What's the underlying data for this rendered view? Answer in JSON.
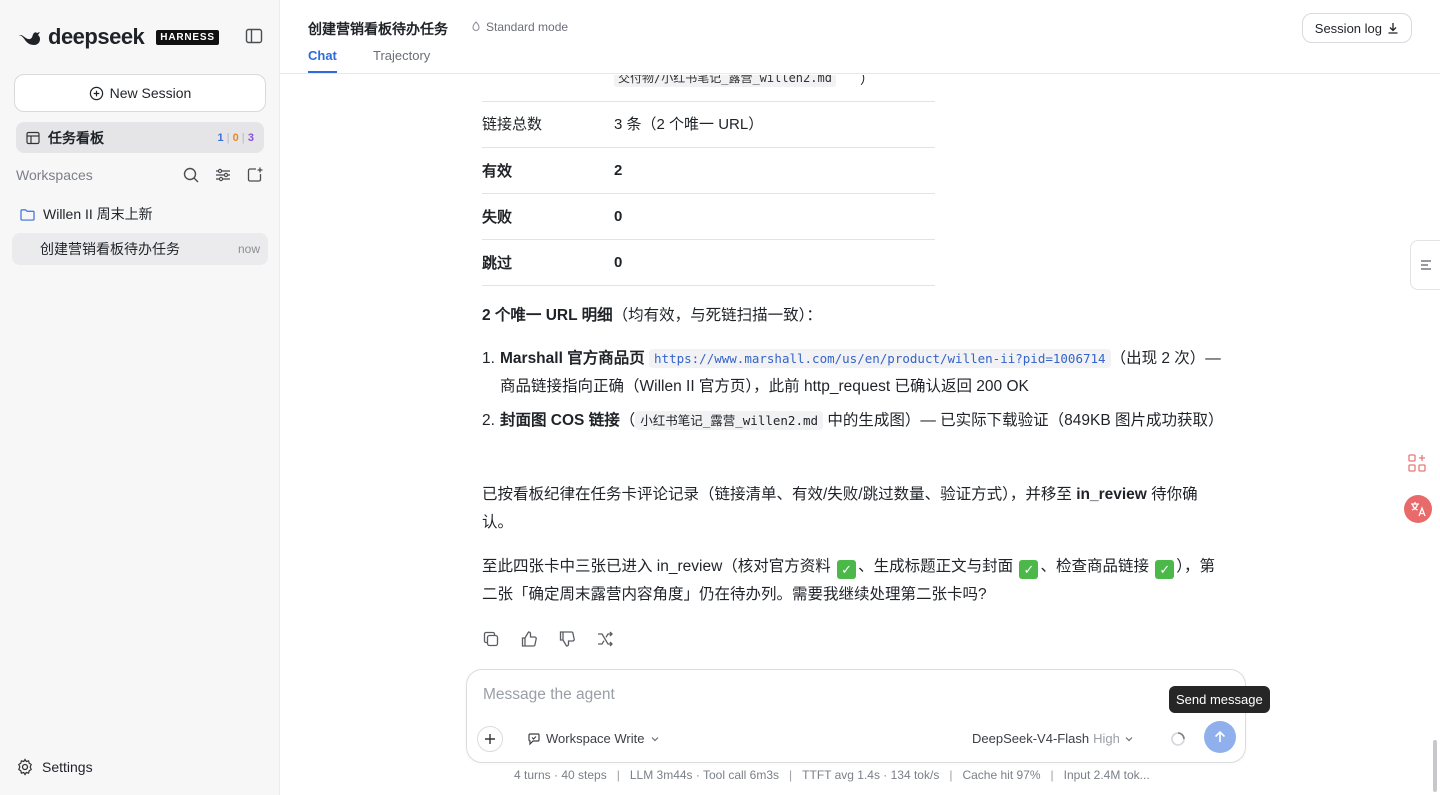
{
  "sidebar": {
    "logo_text": "deepseek",
    "badge": "HARNESS",
    "new_session": "New Session",
    "board": {
      "label": "任务看板",
      "count_a": "1",
      "count_b": "0",
      "count_c": "3"
    },
    "workspaces_label": "Workspaces",
    "workspace": {
      "name": "Willen II 周末上新"
    },
    "session": {
      "title": "创建营销看板待办任务",
      "time": "now"
    },
    "settings": "Settings"
  },
  "header": {
    "title": "创建营销看板待办任务",
    "mode": "Standard mode",
    "session_log": "Session log",
    "tabs": [
      "Chat",
      "Trajectory"
    ]
  },
  "content": {
    "partial_code": "交付物/小红书笔记_露营_willen2.md",
    "partial_close": "）",
    "table": [
      {
        "key": "链接总数",
        "value": "3 条（2 个唯一 URL）",
        "bold": false
      },
      {
        "key": "有效",
        "value": "2",
        "bold": true
      },
      {
        "key": "失败",
        "value": "0",
        "bold": true
      },
      {
        "key": "跳过",
        "value": "0",
        "bold": true
      }
    ],
    "urls_heading_bold": "2 个唯一 URL 明细",
    "urls_heading_rest": "（均有效，与死链扫描一致）：",
    "item1": {
      "num": "1.",
      "bold": "Marshall 官方商品页",
      "code": "https://www.marshall.com/us/en/product/willen-ii?pid=1006714",
      "rest": "（出现 2 次）— 商品链接指向正确（Willen II 官方页），此前 http_request 已确认返回 200 OK"
    },
    "item2": {
      "num": "2.",
      "bold": "封面图 COS 链接",
      "pre": "（",
      "code": "小红书笔记_露营_willen2.md",
      "rest": "中的生成图）— 已实际下载验证（849KB 图片成功获取）"
    },
    "para1_a": "已按看板纪律在任务卡评论记录（链接清单、有效/失败/跳过数量、验证方式），并移至 ",
    "para1_bold": "in_review",
    "para1_b": " 待你确认。",
    "para2_a": "至此四张卡中三张已进入 in_review（核对官方资料",
    "para2_b": "、生成标题正文与封面",
    "para2_c": "、检查商品链接",
    "para2_d": "），第二张「确定周末露营内容角度」仍在待办列。需要我继续处理第二张卡吗?",
    "check_glyph": "✓"
  },
  "composer": {
    "placeholder": "Message the agent",
    "workspace_mode": "Workspace Write",
    "model": "DeepSeek-V4-Flash",
    "level": "High",
    "tooltip": "Send message"
  },
  "stats": {
    "turns": "4 turns · 40 steps",
    "llm": "LLM 3m44s · Tool call 6m3s",
    "ttft": "TTFT avg 1.4s · 134 tok/s",
    "cache": "Cache hit 97%",
    "input": "Input 2.4M tok..."
  },
  "colors": {
    "accent": "#2f6bd8",
    "send_button": "#8fb0ec",
    "check": "#4cb84a"
  }
}
